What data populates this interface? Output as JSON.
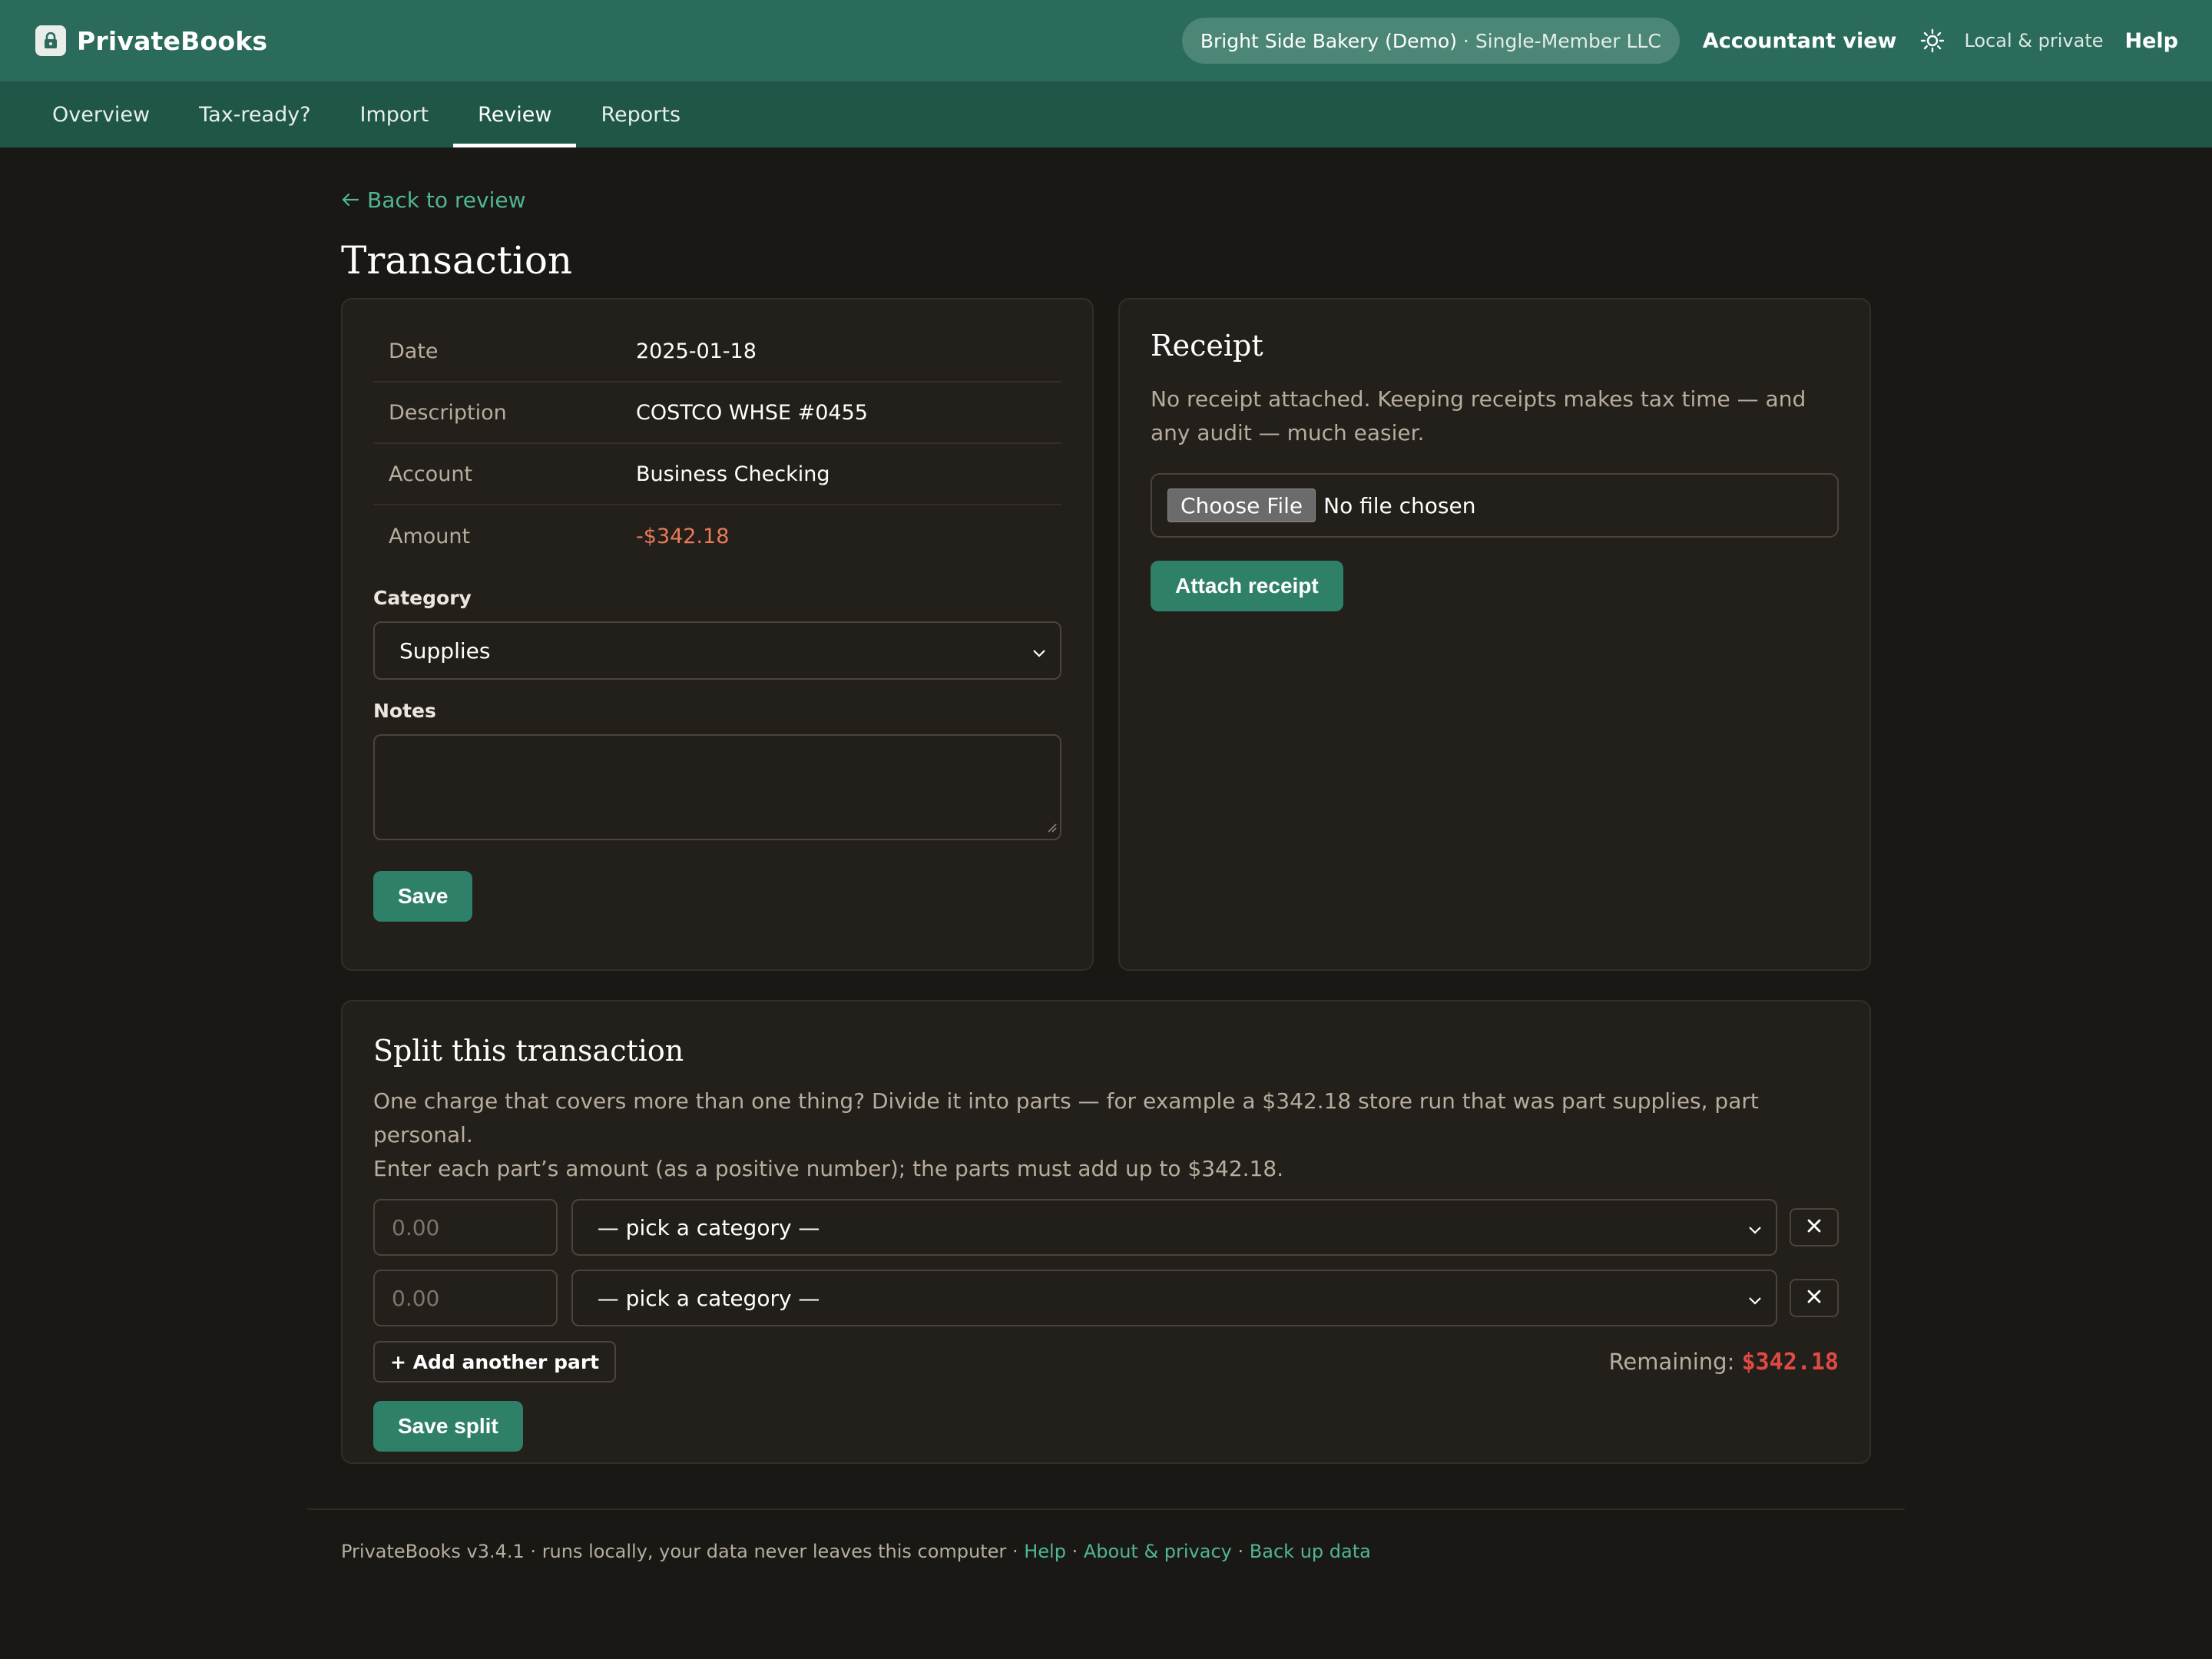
{
  "app": {
    "name": "PrivateBooks",
    "business_name": "Bright Side Bakery (Demo)",
    "business_type": "· Single-Member LLC",
    "accountant_view": "Accountant view",
    "local_label": "Local & private",
    "help_label": "Help"
  },
  "nav": {
    "tabs": [
      {
        "label": "Overview"
      },
      {
        "label": "Tax-ready?"
      },
      {
        "label": "Import"
      },
      {
        "label": "Review",
        "active": true
      },
      {
        "label": "Reports"
      }
    ]
  },
  "page": {
    "back_link": "Back to review",
    "title": "Transaction"
  },
  "transaction": {
    "details": [
      {
        "label": "Date",
        "value": "2025-01-18"
      },
      {
        "label": "Description",
        "value": "COSTCO WHSE #0455"
      },
      {
        "label": "Account",
        "value": "Business Checking"
      },
      {
        "label": "Amount",
        "value": "-$342.18"
      }
    ],
    "category_label": "Category",
    "category_value": "Supplies",
    "notes_label": "Notes",
    "notes_value": "",
    "save_label": "Save"
  },
  "receipt": {
    "title": "Receipt",
    "message": "No receipt attached. Keeping receipts makes tax time — and any audit — much easier.",
    "file_button": "Choose File",
    "file_status": "No file chosen",
    "attach_label": "Attach receipt"
  },
  "split": {
    "title": "Split this transaction",
    "description_line1": "One charge that covers more than one thing? Divide it into parts — for example a $342.18 store run that was part supplies, part personal.",
    "description_line2": "Enter each part’s amount (as a positive number); the parts must add up to $342.18.",
    "parts": [
      {
        "amount_placeholder": "0.00",
        "category_placeholder": "— pick a category —"
      },
      {
        "amount_placeholder": "0.00",
        "category_placeholder": "— pick a category —"
      }
    ],
    "add_part_label": "+ Add another part",
    "remaining_label": "Remaining:",
    "remaining_value": "$342.18",
    "save_split_label": "Save split"
  },
  "footer": {
    "version_text": "PrivateBooks v3.4.1 · runs locally, your data never leaves this computer",
    "sep": "·",
    "help": "Help",
    "about": "About & privacy",
    "backup": "Back up data"
  },
  "colors": {
    "topbar": "#2b6b5b",
    "navbar": "#1f5648",
    "accent": "#2e8068",
    "link": "#4fb793",
    "negative": "#e87b58",
    "remaining": "#e04a45"
  },
  "icons": [
    "lock-icon",
    "sun-icon",
    "arrow-left-icon",
    "chevron-down-icon",
    "close-icon"
  ]
}
